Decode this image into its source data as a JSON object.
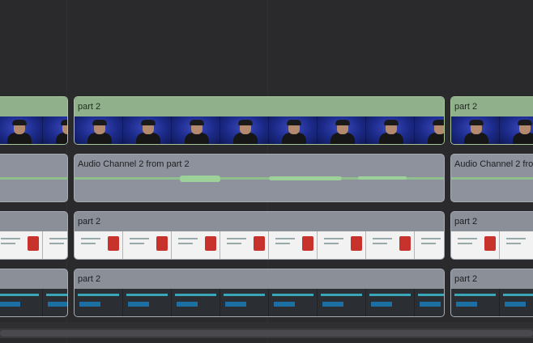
{
  "timeline": {
    "video_track": {
      "clips": [
        {
          "label": ""
        },
        {
          "label": "part 2"
        },
        {
          "label": "part 2"
        }
      ]
    },
    "audio_track": {
      "clips": [
        {
          "label": ""
        },
        {
          "label": "Audio Channel 2 from part 2"
        },
        {
          "label": "Audio Channel 2 from"
        }
      ]
    },
    "screen_track_1": {
      "clips": [
        {
          "label": ""
        },
        {
          "label": "part 2"
        },
        {
          "label": "part 2"
        }
      ]
    },
    "screen_track_2": {
      "clips": [
        {
          "label": ""
        },
        {
          "label": "part 2"
        },
        {
          "label": "part 2"
        }
      ]
    }
  },
  "colors": {
    "video_header": "#8fb08a",
    "audio_clip": "#8d929c",
    "waveform": "#8ec38a",
    "background": "#2a2a2c"
  }
}
